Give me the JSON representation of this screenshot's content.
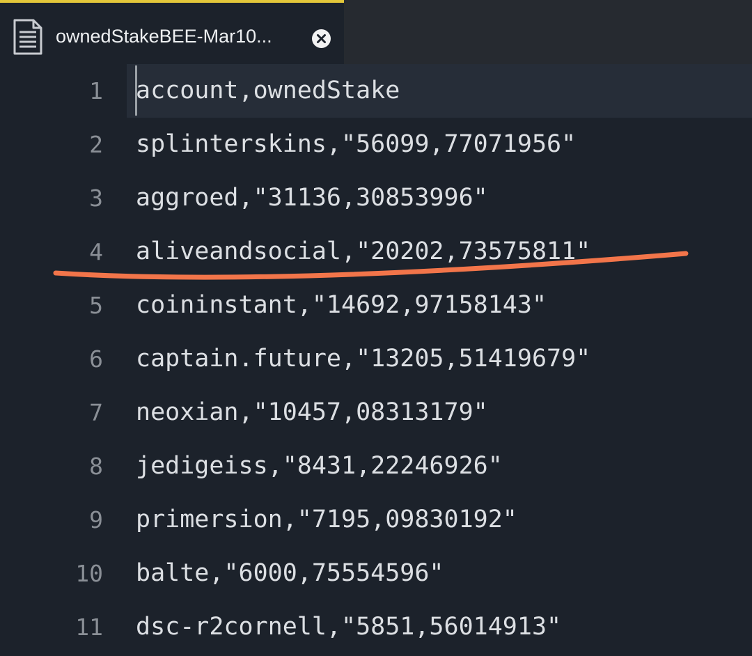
{
  "tab": {
    "title": "ownedStakeBEE-Mar10...",
    "file_icon": "document-icon",
    "close_icon": "close-icon"
  },
  "lines": [
    {
      "number": "1",
      "text": "account,ownedStake"
    },
    {
      "number": "2",
      "text": "splinterskins,\"56099,77071956\""
    },
    {
      "number": "3",
      "text": "aggroed,\"31136,30853996\""
    },
    {
      "number": "4",
      "text": "aliveandsocial,\"20202,73575811\""
    },
    {
      "number": "5",
      "text": "coininstant,\"14692,97158143\""
    },
    {
      "number": "6",
      "text": "captain.future,\"13205,51419679\""
    },
    {
      "number": "7",
      "text": "neoxian,\"10457,08313179\""
    },
    {
      "number": "8",
      "text": "jedigeiss,\"8431,22246926\""
    },
    {
      "number": "9",
      "text": "primersion,\"7195,09830192\""
    },
    {
      "number": "10",
      "text": "balte,\"6000,75554596\""
    },
    {
      "number": "11",
      "text": "dsc-r2cornell,\"5851,56014913\""
    }
  ],
  "colors": {
    "accent_tab": "#e3c73a",
    "annotation_stroke": "#f2754a"
  }
}
